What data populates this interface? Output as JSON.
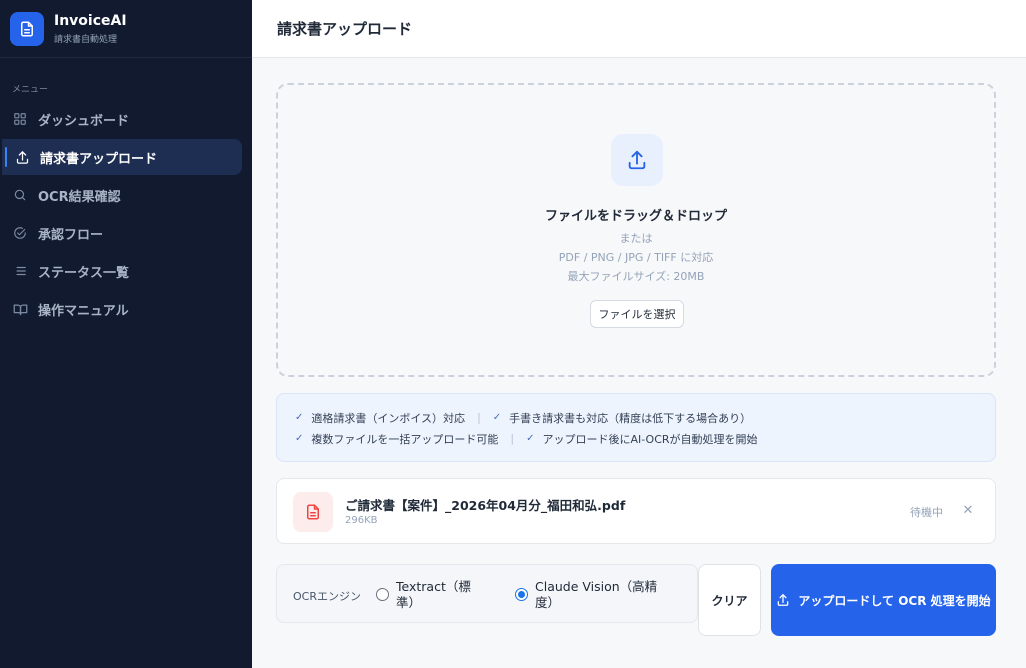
{
  "brand": {
    "name": "InvoiceAI",
    "subtitle": "請求書自動処理"
  },
  "sidebar": {
    "menu_label": "メニュー",
    "items": [
      {
        "label": "ダッシュボード",
        "icon": "grid-icon",
        "active": false
      },
      {
        "label": "請求書アップロード",
        "icon": "upload-icon",
        "active": true
      },
      {
        "label": "OCR結果確認",
        "icon": "search-icon",
        "active": false
      },
      {
        "label": "承認フロー",
        "icon": "check-circle-icon",
        "active": false
      },
      {
        "label": "ステータス一覧",
        "icon": "list-icon",
        "active": false
      },
      {
        "label": "操作マニュアル",
        "icon": "book-icon",
        "active": false
      }
    ]
  },
  "header": {
    "title": "請求書アップロード"
  },
  "dropzone": {
    "title": "ファイルをドラッグ＆ドロップ",
    "or": "または",
    "formats": "PDF / PNG / JPG / TIFF に対応",
    "max_size": "最大ファイルサイズ: 20MB",
    "select_button": "ファイルを選択"
  },
  "info": {
    "row1": [
      "適格請求書（インボイス）対応",
      "手書き請求書も対応（精度は低下する場合あり）"
    ],
    "row2": [
      "複数ファイルを一括アップロード可能",
      "アップロード後にAI-OCRが自動処理を開始"
    ]
  },
  "file": {
    "name": "ご請求書【案件】_2026年04月分_福田和弘.pdf",
    "size": "296KB",
    "status": "待機中"
  },
  "engine": {
    "label": "OCRエンジン",
    "options": [
      {
        "label_line1": "Textract（標",
        "label_line2": "準）",
        "selected": false
      },
      {
        "label_line1": "Claude Vision（高精",
        "label_line2": "度）",
        "selected": true
      }
    ]
  },
  "actions": {
    "clear": "クリア",
    "start": "アップロードして OCR 処理を開始"
  },
  "colors": {
    "accent": "#2563eb",
    "sidebar_bg": "#111a2e",
    "file_icon": "#ef4444"
  }
}
